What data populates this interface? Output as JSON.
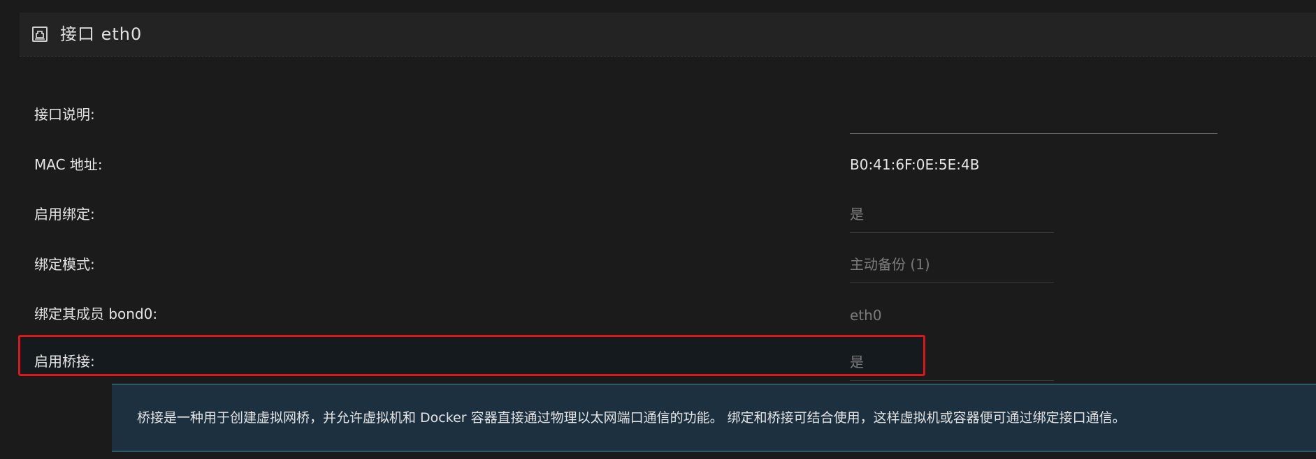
{
  "header": {
    "title": "接口 eth0",
    "icon": "network-port-icon"
  },
  "fields": {
    "description": {
      "label": "接口说明:",
      "value": ""
    },
    "mac": {
      "label": "MAC 地址:",
      "value": "B0:41:6F:0E:5E:4B"
    },
    "bond_enabled": {
      "label": "启用绑定:",
      "value": "是"
    },
    "bond_mode": {
      "label": "绑定模式:",
      "value": "主动备份 (1)"
    },
    "bond_members": {
      "label": "绑定其成员 bond0:",
      "value": "eth0"
    },
    "bridge_enabled": {
      "label": "启用桥接:",
      "value": "是"
    }
  },
  "info": {
    "text": "桥接是一种用于创建虚拟网桥，并允许虚拟机和 Docker 容器直接通过物理以太网端口通信的功能。 绑定和桥接可结合使用，这样虚拟机或容器便可通过绑定接口通信。"
  },
  "colors": {
    "highlight_border": "#d81818",
    "info_background": "#1c3040"
  }
}
